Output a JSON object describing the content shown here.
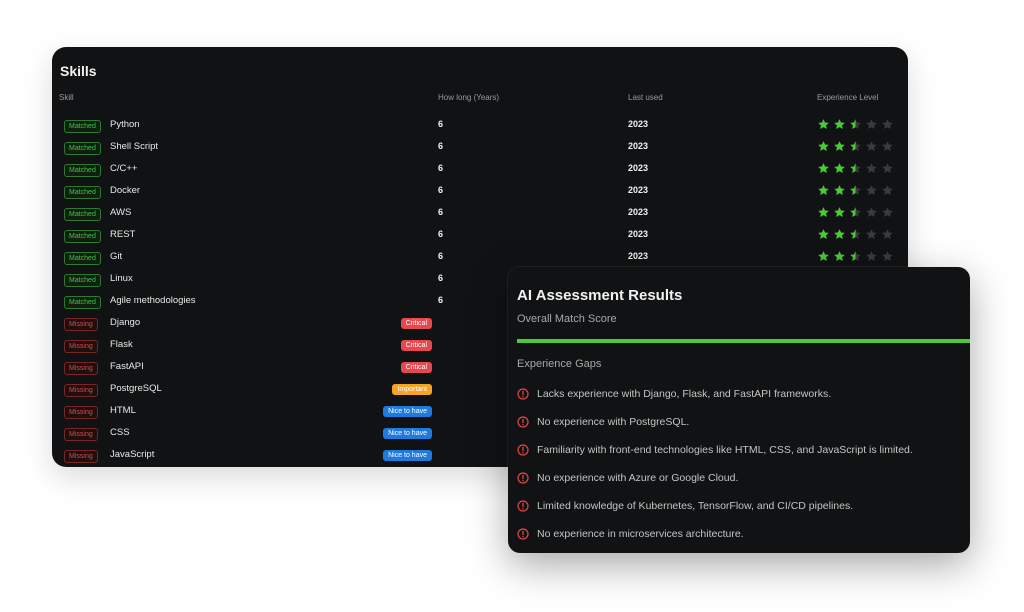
{
  "skills": {
    "title": "Skills",
    "headers": {
      "skill": "Skill",
      "years": "How long (Years)",
      "last_used": "Last used",
      "level": "Experience Level"
    },
    "rows": [
      {
        "status": "Matched",
        "name": "Python",
        "years": "6",
        "last_used": "2023",
        "rating": 2.5
      },
      {
        "status": "Matched",
        "name": "Shell Script",
        "years": "6",
        "last_used": "2023",
        "rating": 2.5
      },
      {
        "status": "Matched",
        "name": "C/C++",
        "years": "6",
        "last_used": "2023",
        "rating": 2.5
      },
      {
        "status": "Matched",
        "name": "Docker",
        "years": "6",
        "last_used": "2023",
        "rating": 2.5
      },
      {
        "status": "Matched",
        "name": "AWS",
        "years": "6",
        "last_used": "2023",
        "rating": 2.5
      },
      {
        "status": "Matched",
        "name": "REST",
        "years": "6",
        "last_used": "2023",
        "rating": 2.5
      },
      {
        "status": "Matched",
        "name": "Git",
        "years": "6",
        "last_used": "2023",
        "rating": 2.5
      },
      {
        "status": "Matched",
        "name": "Linux",
        "years": "6"
      },
      {
        "status": "Matched",
        "name": "Agile methodologies",
        "years": "6"
      },
      {
        "status": "Missing",
        "name": "Django",
        "priority": "Critical"
      },
      {
        "status": "Missing",
        "name": "Flask",
        "priority": "Critical"
      },
      {
        "status": "Missing",
        "name": "FastAPI",
        "priority": "Critical"
      },
      {
        "status": "Missing",
        "name": "PostgreSQL",
        "priority": "Important"
      },
      {
        "status": "Missing",
        "name": "HTML",
        "priority": "Nice to have"
      },
      {
        "status": "Missing",
        "name": "CSS",
        "priority": "Nice to have"
      },
      {
        "status": "Missing",
        "name": "JavaScript",
        "priority": "Nice to have"
      }
    ]
  },
  "assessment": {
    "title": "AI Assessment Results",
    "match_label": "Overall Match Score",
    "match_progress": 1.0,
    "gaps_label": "Experience Gaps",
    "gaps": [
      "Lacks experience with Django, Flask, and FastAPI frameworks.",
      "No experience with PostgreSQL.",
      "Familiarity with front-end technologies like HTML, CSS, and JavaScript is limited.",
      "No experience with Azure or Google Cloud.",
      "Limited knowledge of Kubernetes, TensorFlow, and CI/CD pipelines.",
      "No experience in microservices architecture."
    ]
  },
  "colors": {
    "matched": "#44c447",
    "missing": "#e04848",
    "critical": "#e5484d",
    "important": "#f5a524",
    "nice_to_have": "#1f7ae0",
    "star_filled": "#4cc83a",
    "star_empty": "#3a3a3a",
    "match_bar": "#4cc83a",
    "gap_icon": "#e04848"
  },
  "icons": {
    "star": "star-icon",
    "gap": "alert-circle-icon"
  }
}
